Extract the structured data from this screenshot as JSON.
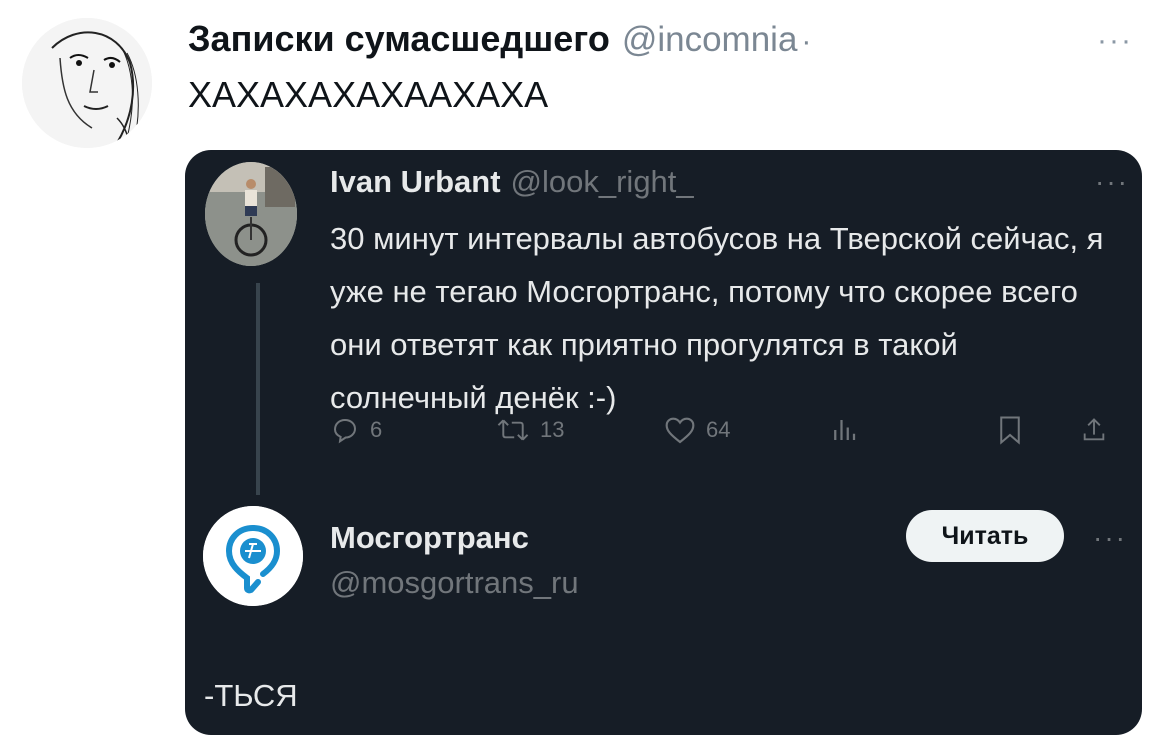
{
  "outer_tweet": {
    "author": "Записки сумасшедшего",
    "handle": "@incomnia",
    "separator": "·",
    "text": "ХАХАХАХАХААХАХА",
    "more_label": "···"
  },
  "quoted_tweet": {
    "author": "Ivan Urbant",
    "handle": "@look_right_",
    "text": "30 минут интервалы автобусов на Тверской сейчас, я уже не тегаю Мосгортранс, потому что скорее всего они ответят как приятно прогулятся в такой солнечный денёк :-)",
    "more_label": "···",
    "stats": {
      "replies": "6",
      "retweets": "13",
      "likes": "64"
    }
  },
  "account_card": {
    "name": "Мосгортранс",
    "handle": "@mosgortrans_ru",
    "follow_label": "Читать",
    "more_label": "···"
  },
  "suffix_text": "-ТЬСЯ",
  "colors": {
    "card_bg": "#161d26",
    "text_light": "#e7e9ea",
    "text_muted": "#71767b",
    "brand_blue": "#1a8fcf"
  }
}
